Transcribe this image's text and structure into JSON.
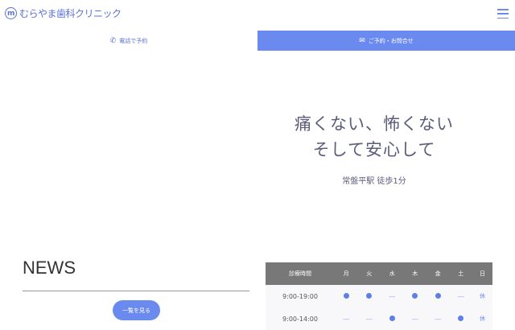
{
  "header": {
    "logo_mark": "m",
    "logo_text": "むらやま歯科クリニック"
  },
  "tabs": {
    "phone": "電話で予約",
    "contact": "ご予約・お問合せ"
  },
  "hero": {
    "line1": "痛くない、怖くない",
    "line2": "そして安心して",
    "sub": "常盤平駅 徒歩1分"
  },
  "news": {
    "title": "NEWS",
    "button": "一覧を見る"
  },
  "hours": {
    "header": [
      "診療時間",
      "月",
      "火",
      "水",
      "木",
      "金",
      "土",
      "日"
    ],
    "rows": [
      {
        "time": "9:00-19:00",
        "days": [
          "●",
          "●",
          "―",
          "●",
          "●",
          "―",
          "休"
        ]
      },
      {
        "time": "9:00-14:00",
        "days": [
          "―",
          "―",
          "●",
          "―",
          "―",
          "●",
          "休"
        ]
      }
    ]
  },
  "colors": {
    "accent": "#6b8af0",
    "table_header": "#787878"
  }
}
